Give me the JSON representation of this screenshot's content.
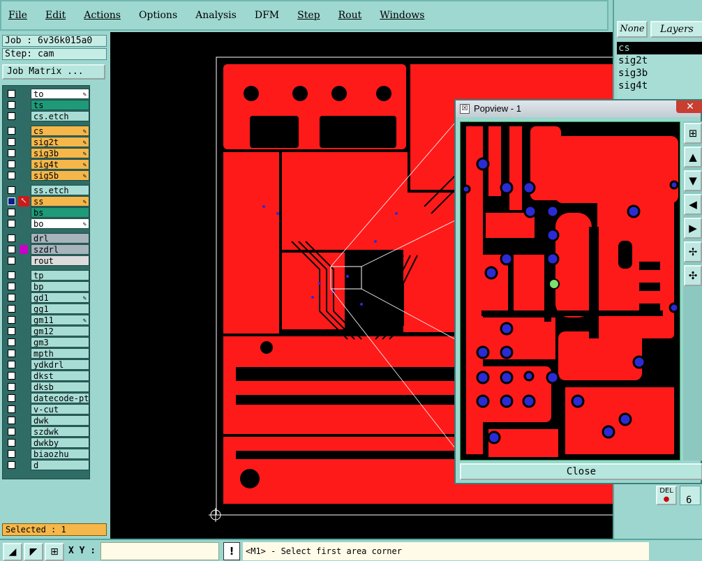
{
  "menu": {
    "items": [
      {
        "label": "File",
        "underline": true
      },
      {
        "label": "Edit",
        "underline": true
      },
      {
        "label": "Actions",
        "underline": true
      },
      {
        "label": "Options",
        "underline": false
      },
      {
        "label": "Analysis",
        "underline": false
      },
      {
        "label": "DFM",
        "underline": false
      },
      {
        "label": "Step",
        "underline": true
      },
      {
        "label": "Rout",
        "underline": true
      },
      {
        "label": "Windows",
        "underline": true
      }
    ]
  },
  "left": {
    "job": "Job : 6v36k015a0",
    "step": "Step: cam",
    "job_matrix": "Job Matrix ...",
    "selected": "Selected : 1",
    "layers": [
      {
        "name": "to",
        "color": "#ffffff",
        "flag": "✎"
      },
      {
        "name": "ts",
        "color": "#1e9a78",
        "flag": ""
      },
      {
        "name": "cs.etch",
        "color": "#a8ddd6",
        "flag": ""
      },
      {
        "name": "cs",
        "color": "#f5b74a",
        "flag": "✎"
      },
      {
        "name": "sig2t",
        "color": "#f5b74a",
        "flag": "✎"
      },
      {
        "name": "sig3b",
        "color": "#f5b74a",
        "flag": "✎"
      },
      {
        "name": "sig4t",
        "color": "#f5b74a",
        "flag": "✎"
      },
      {
        "name": "sig5b",
        "color": "#f5b74a",
        "flag": "✎"
      },
      {
        "name": "ss.etch",
        "color": "#a8ddd6",
        "flag": ""
      },
      {
        "name": "ss",
        "color": "#f5b74a",
        "flag": "✎"
      },
      {
        "name": "bs",
        "color": "#1e9a78",
        "flag": ""
      },
      {
        "name": "bo",
        "color": "#ffffff",
        "flag": "✎"
      },
      {
        "name": "drl",
        "color": "#a7b4bc",
        "flag": ""
      },
      {
        "name": "szdrl",
        "color": "#a7b4bc",
        "flag": ""
      },
      {
        "name": "rout",
        "color": "#dcdcdc",
        "flag": ""
      },
      {
        "name": "tp",
        "color": "#a8ddd6",
        "flag": ""
      },
      {
        "name": "bp",
        "color": "#a8ddd6",
        "flag": ""
      },
      {
        "name": "gd1",
        "color": "#a8ddd6",
        "flag": "✎"
      },
      {
        "name": "gg1",
        "color": "#a8ddd6",
        "flag": ""
      },
      {
        "name": "gm11",
        "color": "#a8ddd6",
        "flag": "✎"
      },
      {
        "name": "gm12",
        "color": "#a8ddd6",
        "flag": ""
      },
      {
        "name": "gm3",
        "color": "#a8ddd6",
        "flag": ""
      },
      {
        "name": "mpth",
        "color": "#a8ddd6",
        "flag": ""
      },
      {
        "name": "ydkdrl",
        "color": "#a8ddd6",
        "flag": ""
      },
      {
        "name": "dkst",
        "color": "#a8ddd6",
        "flag": ""
      },
      {
        "name": "dksb",
        "color": "#a8ddd6",
        "flag": ""
      },
      {
        "name": "datecode-pte",
        "color": "#a8ddd6",
        "flag": ""
      },
      {
        "name": "v-cut",
        "color": "#a8ddd6",
        "flag": ""
      },
      {
        "name": "dwk",
        "color": "#a8ddd6",
        "flag": ""
      },
      {
        "name": "szdwk",
        "color": "#a8ddd6",
        "flag": ""
      },
      {
        "name": "dwkby",
        "color": "#a8ddd6",
        "flag": ""
      },
      {
        "name": "biaozhu",
        "color": "#a8ddd6",
        "flag": ""
      },
      {
        "name": "d",
        "color": "#a8ddd6",
        "flag": ""
      }
    ]
  },
  "right": {
    "none_label": "None",
    "layers_title": "Layers",
    "layers": [
      "cs",
      "sig2t",
      "sig3b",
      "sig4t"
    ],
    "del_label": "DEL",
    "partial_value": "6"
  },
  "popview": {
    "title": "Popview - 1",
    "close_label": "Close",
    "close_x": "✕"
  },
  "bottom": {
    "xy_label": "X Y :",
    "xy_value": "",
    "warn": "!",
    "status": "<M1> - Select first area corner"
  },
  "colors": {
    "copper": "#ff1a1a",
    "board_bg": "#000000",
    "via": "#2b2bd6",
    "accent_teal": "#9cd6ce",
    "highlight_orange": "#f5b74a"
  }
}
